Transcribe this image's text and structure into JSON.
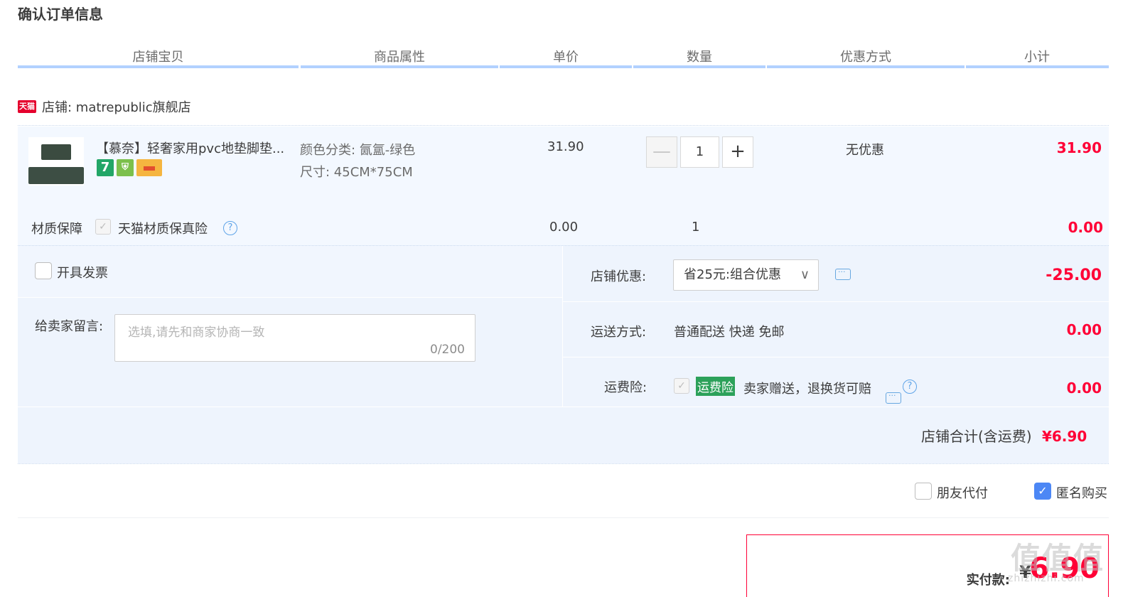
{
  "page_title": "确认订单信息",
  "columns": [
    "店铺宝贝",
    "商品属性",
    "单价",
    "数量",
    "优惠方式",
    "小计"
  ],
  "shop": {
    "logo": "天猫",
    "label": "店铺: matrepublic旗舰店"
  },
  "item": {
    "name": "【慕奈】轻奢家用pvc地垫脚垫...",
    "badges": [
      "7",
      "shield-badge-icon",
      "card-badge-icon"
    ],
    "color_attr": "颜色分类: 氤氲-绿色",
    "size_attr": "尺寸: 45CM*75CM",
    "unit_price": "31.90",
    "quantity": "1",
    "qty_minus": "—",
    "qty_plus": "+",
    "discount": "无优惠",
    "subtotal": "31.90"
  },
  "insurance": {
    "label": "材质保障",
    "check": "✓",
    "name": "天猫材质保真险",
    "help": "?",
    "price": "0.00",
    "quantity": "1",
    "subtotal": "0.00"
  },
  "invoice": {
    "label": "开具发票"
  },
  "message": {
    "label": "给卖家留言:",
    "placeholder": "选填,请先和商家协商一致",
    "count": "0/200"
  },
  "shop_discount": {
    "label": "店铺优惠:",
    "selected": "省25元:组合优惠",
    "chevron": "∨",
    "amount": "-25.00"
  },
  "shipping": {
    "label": "运送方式:",
    "value": "普通配送 快递 免邮",
    "amount": "0.00"
  },
  "freight_insurance": {
    "label": "运费险:",
    "check": "✓",
    "tag": "运费险",
    "desc": "卖家赠送，退换货可赔",
    "help": "?",
    "amount": "0.00"
  },
  "shop_total": {
    "label": "店铺合计(含运费)",
    "amount": "¥6.90"
  },
  "options": {
    "friend_pay": "朋友代付",
    "anonymous": "匿名购买",
    "anonymous_checked": "✓"
  },
  "payment": {
    "label": "实付款:",
    "currency": "¥",
    "amount": "6.90"
  },
  "watermark": {
    "logo": "值值值",
    "site": "zhizhizhi.com"
  },
  "colors": {
    "accent_red": "#ff0036",
    "header_line": "#b2d1ff",
    "panel_bg": "#eef4fd",
    "checkbox_blue": "#4c87f5",
    "tag_green": "#2ca15a"
  }
}
